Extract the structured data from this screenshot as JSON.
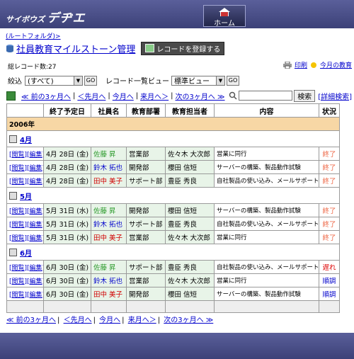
{
  "header": {
    "logo_small": "サイボウズ",
    "logo_big": "デヂエ",
    "home_label": "ホーム"
  },
  "breadcrumb": "(ルートフォルダ)>",
  "app": {
    "title": "社員教育マイルストーン管理",
    "register_label": "レコードを登録する"
  },
  "record_count": "総レコード数:27",
  "top_links": {
    "print": "印刷",
    "today": "今月の教育"
  },
  "filter": {
    "label": "絞込",
    "value": "(すべて)",
    "go": "GO",
    "view_label": "レコード一覧ビュー",
    "view_value": "標準ビュー"
  },
  "nav": {
    "prev3": "≪ 前の3ヶ月へ",
    "prev": "＜先月へ",
    "this": "今月へ",
    "next": "来月へ＞",
    "next3": "次の3ヶ月へ ≫"
  },
  "search": {
    "button": "検索",
    "advanced": "[詳細検索]"
  },
  "columns": {
    "due": "終了予定日",
    "name": "社員名",
    "dept": "教育部署",
    "owner": "教育担当者",
    "content": "内容",
    "status": "状況"
  },
  "year": "2006年",
  "months": [
    {
      "label": "4月",
      "rows": [
        {
          "view": "[閲覧]",
          "edit": "[編集]",
          "date": "4月 28日 (金)",
          "name": "佐藤 昇",
          "name_color": "green",
          "dept": "営業部",
          "owner": "佐々木 大次郎",
          "content": "営業に同行",
          "status": "終了",
          "status_kind": "done"
        },
        {
          "view": "[閲覧]",
          "edit": "[編集]",
          "date": "4月 28日 (金)",
          "name": "鈴木 拓也",
          "name_color": "blue",
          "dept": "開発部",
          "owner": "櫻田 信短",
          "content": "サーバーの構築、製品動作試験",
          "status": "終了",
          "status_kind": "done"
        },
        {
          "view": "[閲覧]",
          "edit": "[編集]",
          "date": "4月 28日 (金)",
          "name": "田中 美子",
          "name_color": "red",
          "dept": "サポート部",
          "owner": "豊臣 秀良",
          "content": "自社製品の使い込み、メールサポート",
          "status": "終了",
          "status_kind": "done"
        }
      ]
    },
    {
      "label": "5月",
      "rows": [
        {
          "view": "[閲覧]",
          "edit": "[編集]",
          "date": "5月 31日 (水)",
          "name": "佐藤 昇",
          "name_color": "green",
          "dept": "開発部",
          "owner": "櫻田 信短",
          "content": "サーバーの構築、製品動作試験",
          "status": "終了",
          "status_kind": "done"
        },
        {
          "view": "[閲覧]",
          "edit": "[編集]",
          "date": "5月 31日 (水)",
          "name": "鈴木 拓也",
          "name_color": "blue",
          "dept": "サポート部",
          "owner": "豊臣 秀良",
          "content": "自社製品の使い込み、メールサポート",
          "status": "終了",
          "status_kind": "done"
        },
        {
          "view": "[閲覧]",
          "edit": "[編集]",
          "date": "5月 31日 (水)",
          "name": "田中 美子",
          "name_color": "red",
          "dept": "営業部",
          "owner": "佐々木 大次郎",
          "content": "営業に同行",
          "status": "終了",
          "status_kind": "done"
        }
      ]
    },
    {
      "label": "6月",
      "rows": [
        {
          "view": "[閲覧]",
          "edit": "[編集]",
          "date": "6月 30日 (金)",
          "name": "佐藤 昇",
          "name_color": "green",
          "dept": "サポート部",
          "owner": "豊臣 秀良",
          "content": "自社製品の使い込み、メールサポート",
          "status": "遅れ",
          "status_kind": "late"
        },
        {
          "view": "[閲覧]",
          "edit": "[編集]",
          "date": "6月 30日 (金)",
          "name": "鈴木 拓也",
          "name_color": "blue",
          "dept": "営業部",
          "owner": "佐々木 大次郎",
          "content": "営業に同行",
          "status": "順調",
          "status_kind": "ok"
        },
        {
          "view": "[閲覧]",
          "edit": "[編集]",
          "date": "6月 30日 (金)",
          "name": "田中 美子",
          "name_color": "red",
          "dept": "開発部",
          "owner": "櫻田 信短",
          "content": "サーバーの構築、製品動作試験",
          "status": "順調",
          "status_kind": "ok"
        }
      ]
    }
  ],
  "bottom_nav": {
    "prev3": "≪ 前の3ヶ月へ",
    "prev": "＜先月へ",
    "this": "今月へ",
    "next": "来月へ＞",
    "next3": "次の3ヶ月へ ≫"
  }
}
